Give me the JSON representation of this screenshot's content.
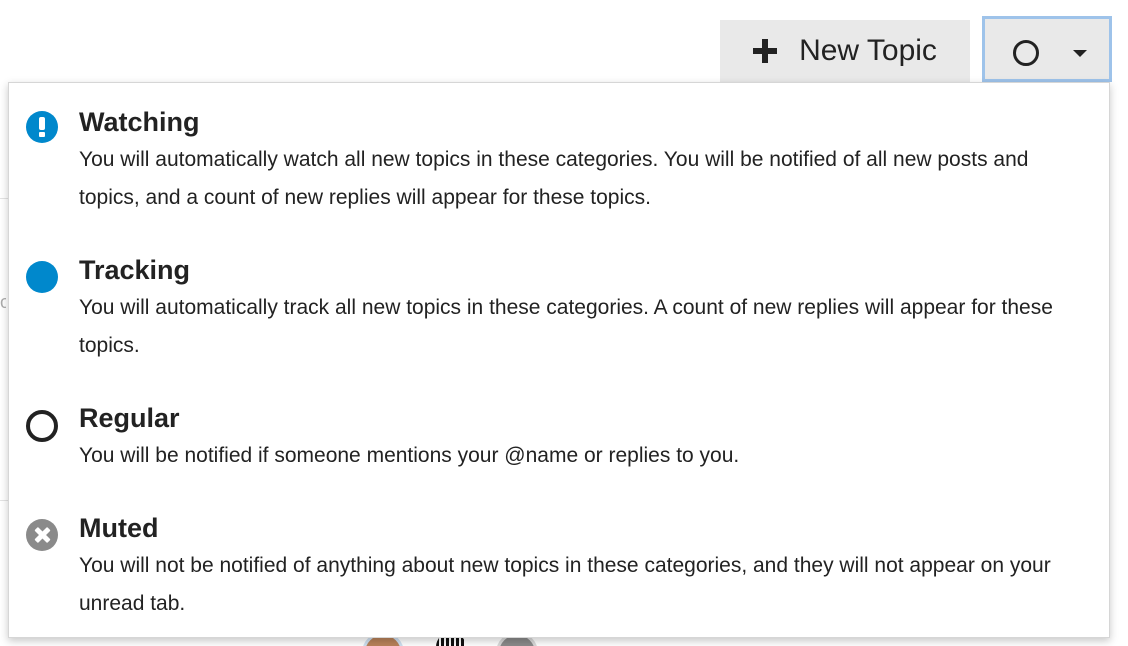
{
  "header": {
    "new_topic_label": "New Topic",
    "new_topic_icon": "plus-icon",
    "notification_button_icon": "circle-outline-icon",
    "notification_caret_icon": "caret-down-icon"
  },
  "dropdown": {
    "options": [
      {
        "title": "Watching",
        "description": "You will automatically watch all new topics in these categories. You will be notified of all new posts and topics, and a count of new replies will appear for these topics.",
        "icon": "exclamation-circle-icon",
        "color": "#0088cc"
      },
      {
        "title": "Tracking",
        "description": "You will automatically track all new topics in these categories. A count of new replies will appear for these topics.",
        "icon": "filled-circle-icon",
        "color": "#0088cc"
      },
      {
        "title": "Regular",
        "description": "You will be notified if someone mentions your @name or replies to you.",
        "icon": "circle-outline-icon",
        "color": "#222222"
      },
      {
        "title": "Muted",
        "description": "You will not be notified of anything about new topics in these categories, and they will not appear on your unread tab.",
        "icon": "times-circle-icon",
        "color": "#8a8a8a"
      }
    ]
  },
  "colors": {
    "accent": "#0088cc",
    "button_bg": "#e9e9e9",
    "focus_border": "#9ec3ea"
  }
}
